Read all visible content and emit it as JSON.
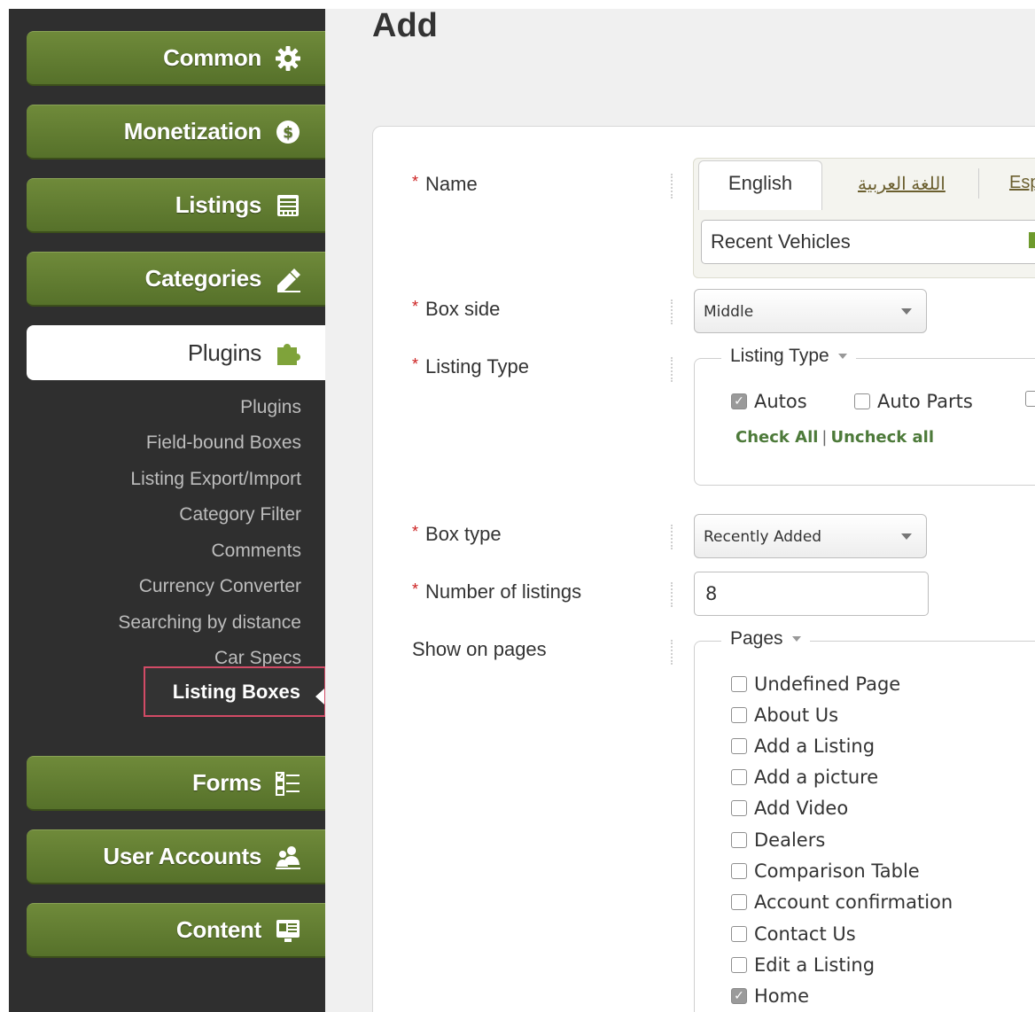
{
  "sidebar": {
    "common": "Common",
    "monetization": "Monetization",
    "listings": "Listings",
    "categories": "Categories",
    "plugins": "Plugins",
    "forms": "Forms",
    "user_accounts": "User Accounts",
    "content": "Content",
    "plugins_submenu": [
      "Plugins",
      "Field-bound Boxes",
      "Listing Export/Import",
      "Category Filter",
      "Comments",
      "Currency Converter",
      "Searching by distance",
      "Car Specs"
    ],
    "selected_submenu": "Listing Boxes"
  },
  "main": {
    "title": "Add",
    "labels": {
      "name": "Name",
      "box_side": "Box side",
      "listing_type": "Listing Type",
      "box_type": "Box type",
      "number_of_listings": "Number of listings",
      "show_on_pages": "Show on pages"
    },
    "tabs": {
      "english": "English",
      "arabic": "اللغة العربية",
      "spanish_partial": "Esp"
    },
    "name_value": "Recent Vehicles",
    "box_side_value": "Middle",
    "listing_type_legend": "Listing Type",
    "listing_types": [
      {
        "label": "Autos",
        "checked": true
      },
      {
        "label": "Auto Parts",
        "checked": false
      }
    ],
    "check_all": "Check All",
    "uncheck_all": "Uncheck all",
    "box_type_value": "Recently Added",
    "number_of_listings_value": "8",
    "pages_legend": "Pages",
    "pages": [
      {
        "label": "Undefined Page",
        "checked": false
      },
      {
        "label": "About Us",
        "checked": false
      },
      {
        "label": "Add a Listing",
        "checked": false
      },
      {
        "label": "Add a picture",
        "checked": false
      },
      {
        "label": "Add Video",
        "checked": false
      },
      {
        "label": "Dealers",
        "checked": false
      },
      {
        "label": "Comparison Table",
        "checked": false
      },
      {
        "label": "Account confirmation",
        "checked": false
      },
      {
        "label": "Contact Us",
        "checked": false
      },
      {
        "label": "Edit a Listing",
        "checked": false
      },
      {
        "label": "Home",
        "checked": true
      }
    ]
  },
  "colors": {
    "nav_green": "#62802f",
    "sidebar_dark": "#2f2f2f",
    "required_star": "#cc1f1f",
    "selection_outline": "#d24b66",
    "check_links": "#4d7a3a"
  }
}
